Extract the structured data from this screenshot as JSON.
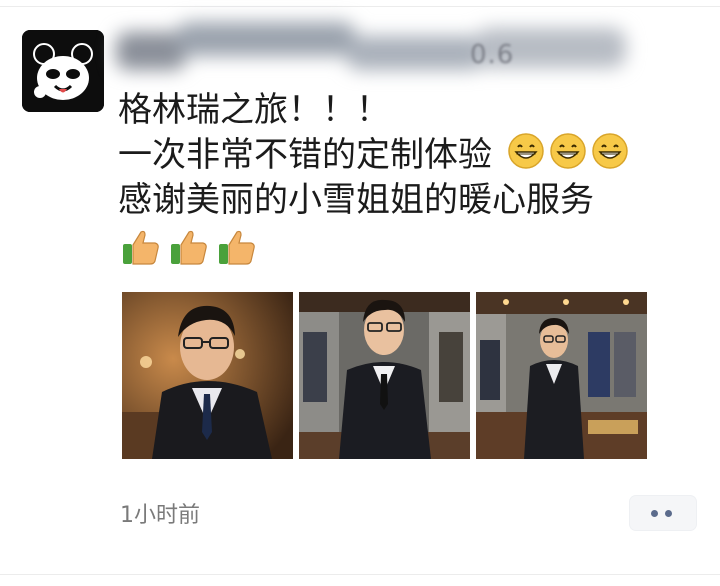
{
  "post": {
    "author_name_obscured": "0.6",
    "lines": [
      "格林瑞之旅！！！",
      "一次非常不错的定制体验",
      "感谢美丽的小雪姐姐的暖心服务"
    ],
    "emoji": {
      "grin": "grinning-face-emoji",
      "thumb": "thumbs-up-emoji"
    },
    "photos": [
      {
        "subject": "man-with-glasses-in-suit"
      },
      {
        "subject": "man-in-double-breasted-suit"
      },
      {
        "subject": "man-in-suit-full-body"
      }
    ],
    "time": "1小时前"
  },
  "colors": {
    "text": "#1b1b1b",
    "meta": "#7a7a7a",
    "more_dots": "#5b6b8c"
  }
}
